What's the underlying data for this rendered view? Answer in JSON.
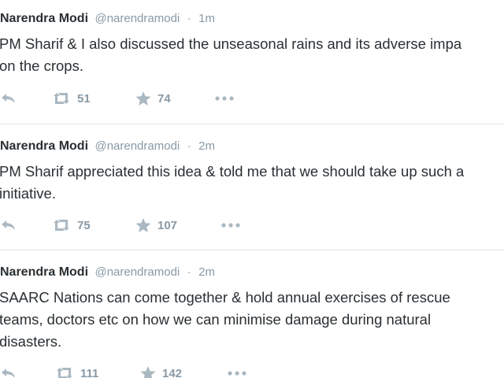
{
  "tweets": [
    {
      "name": "Narendra Modi",
      "handle": "@narendramodi",
      "separator": "·",
      "time": "1m",
      "text_lines": [
        "PM Sharif & I also discussed the unseasonal rains and its adverse impa",
        "on the crops."
      ],
      "retweets": "51",
      "favorites": "74",
      "icons": [
        "reply-icon",
        "retweet-icon",
        "favorite-star-icon",
        "more-dots-icon"
      ]
    },
    {
      "name": "Narendra Modi",
      "handle": "@narendramodi",
      "separator": "·",
      "time": "2m",
      "text_lines": [
        "PM Sharif appreciated this idea & told me that we should take up such a",
        "initiative."
      ],
      "retweets": "75",
      "favorites": "107",
      "icons": [
        "reply-icon",
        "retweet-icon",
        "favorite-star-icon",
        "more-dots-icon"
      ]
    },
    {
      "name": "Narendra Modi",
      "handle": "@narendramodi",
      "separator": "·",
      "time": "2m",
      "text_lines": [
        "SAARC Nations can come together & hold annual exercises of rescue",
        "teams, doctors etc on how we can minimise damage during natural",
        "disasters."
      ],
      "retweets": "111",
      "favorites": "142",
      "icons": [
        "reply-icon",
        "retweet-icon",
        "favorite-star-icon",
        "more-dots-icon"
      ]
    }
  ],
  "colors": {
    "name": "#292f33",
    "meta": "#8899a6",
    "action_icon": "#aab8c2",
    "separator": "#e1e8ed"
  }
}
